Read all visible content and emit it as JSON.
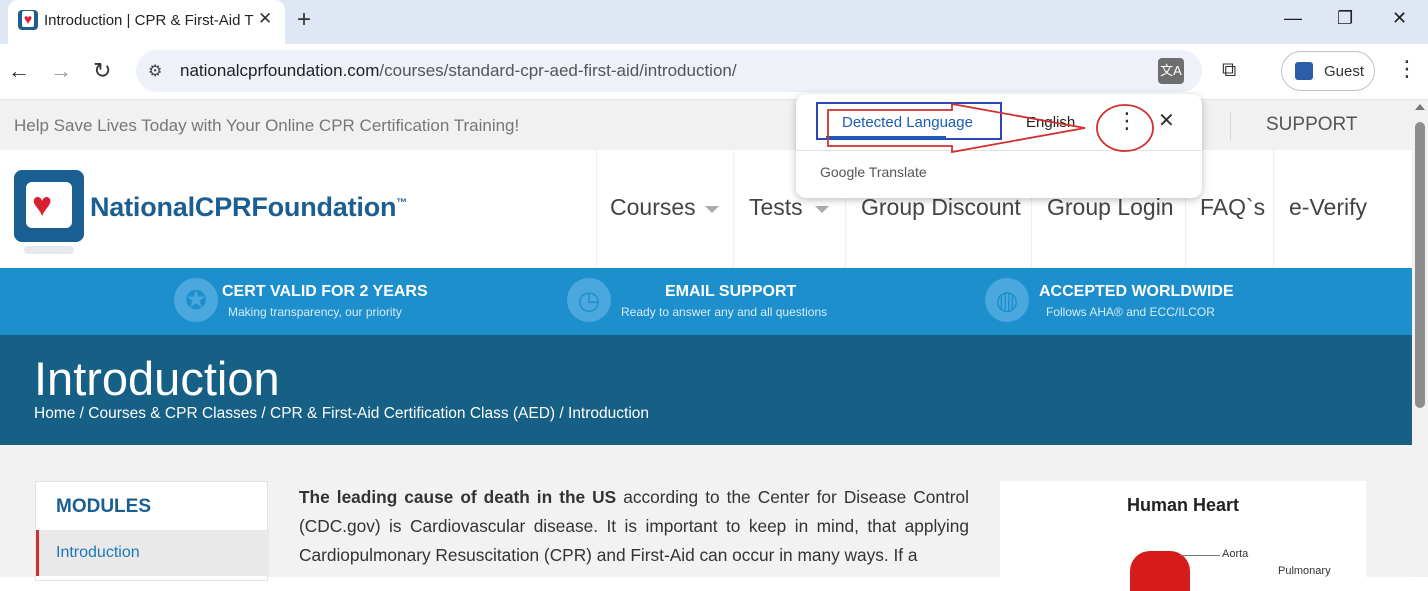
{
  "browser": {
    "tab_title": "Introduction | CPR & First-Aid T",
    "tab_close": "✕",
    "new_tab": "+",
    "window_controls": {
      "minimize": "—",
      "maximize": "❐",
      "close": "✕"
    },
    "nav": {
      "back": "←",
      "forward": "→",
      "reload": "↻"
    },
    "url_host": "nationalcprfoundation.com",
    "url_path": "/courses/standard-cpr-aed-first-aid/introduction/",
    "translate_icon": "文A",
    "cast_icon": "⧉",
    "profile_name": "Guest",
    "menu": "⋮"
  },
  "page": {
    "tagline": "Help Save Lives Today with Your Online CPR Certification Training!",
    "support": "SUPPORT",
    "brand": "NationalCPRFoundation",
    "brand_tm": "™",
    "nav": [
      "Courses",
      "Tests",
      "Group Discount",
      "Group Login",
      "FAQ`s",
      "e-Verify"
    ],
    "features": [
      {
        "title": "CERT VALID FOR 2 YEARS",
        "sub": "Making transparency, our priority",
        "icon": "ribbon-icon"
      },
      {
        "title": "EMAIL SUPPORT",
        "sub": "Ready to answer any and all questions",
        "icon": "clock-icon"
      },
      {
        "title": "ACCEPTED WORLDWIDE",
        "sub": "Follows AHA® and ECC/ILCOR",
        "icon": "globe-icon"
      }
    ],
    "hero_title": "Introduction",
    "breadcrumb": "Home / Courses & CPR Classes / CPR & First-Aid Certification Class (AED) / Introduction",
    "modules_heading": "MODULES",
    "modules_active": "Introduction",
    "article_bold": "The leading cause of death in the US",
    "article_text": " according to the Center for Disease Control (CDC.gov) is Cardiovascular disease. It is important to keep in mind, that applying Cardiopulmonary Resuscitation (CPR) and First-Aid can occur in many ways. If a",
    "figure_title": "Human Heart",
    "figure_labels": [
      "Aorta",
      "Pulmonary"
    ]
  },
  "translate_popup": {
    "detected_tab": "Detected Language",
    "english_tab": "English",
    "options": "⋮",
    "close": "✕",
    "brand": "Google Translate"
  },
  "colors": {
    "brand_blue": "#1b5e91",
    "feature_bar": "#1d8fcc",
    "hero_bg": "#165f85",
    "annotation_red": "#d0312d",
    "annotation_box": "#2947b6"
  }
}
